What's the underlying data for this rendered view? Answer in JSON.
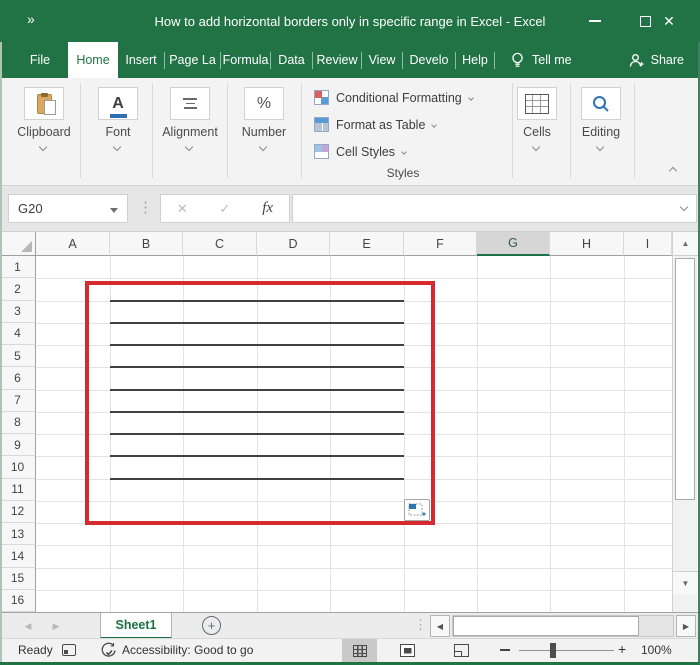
{
  "window": {
    "title": "How to add horizontal borders only in specific range in Excel - Excel"
  },
  "icons": {
    "quick_access": "»",
    "close": "✕",
    "cancel": "✕",
    "enter": "✓",
    "dots": "⋮",
    "up_arrow": "▲",
    "down_arrow": "▼",
    "left_arrow": "◀",
    "right_arrow": "▶",
    "plus": "+"
  },
  "menu": {
    "tabs": [
      {
        "label": "File",
        "active": false
      },
      {
        "label": "Home",
        "active": true
      },
      {
        "label": "Insert",
        "active": false
      },
      {
        "label": "Page La",
        "active": false
      },
      {
        "label": "Formula",
        "active": false
      },
      {
        "label": "Data",
        "active": false
      },
      {
        "label": "Review",
        "active": false
      },
      {
        "label": "View",
        "active": false
      },
      {
        "label": "Develo",
        "active": false
      },
      {
        "label": "Help",
        "active": false
      }
    ],
    "tell_me": "Tell me",
    "share": "Share"
  },
  "ribbon": {
    "groups": [
      {
        "label": "Clipboard",
        "icon": "clipboard-icon"
      },
      {
        "label": "Font",
        "icon": "font-underline-icon"
      },
      {
        "label": "Alignment",
        "icon": "align-lines-icon"
      },
      {
        "label": "Number",
        "icon": "percent-icon"
      }
    ],
    "styles": {
      "items": [
        {
          "label": "Conditional Formatting"
        },
        {
          "label": "Format as Table"
        },
        {
          "label": "Cell Styles"
        }
      ],
      "label": "Styles"
    },
    "cells": {
      "label": "Cells",
      "icon": "cells-grid-icon"
    },
    "editing": {
      "label": "Editing",
      "icon": "magnifier-icon"
    }
  },
  "formula_bar": {
    "name_box_value": "G20",
    "fx_label": "fx",
    "formula_value": ""
  },
  "grid": {
    "column_headers": [
      "A",
      "B",
      "C",
      "D",
      "E",
      "F",
      "G",
      "H",
      "I"
    ],
    "selected_column": "G",
    "row_headers": [
      "1",
      "2",
      "3",
      "4",
      "5",
      "6",
      "7",
      "8",
      "9",
      "10",
      "11",
      "12",
      "13",
      "14",
      "15",
      "16"
    ],
    "drawn_borders": {
      "first_row": 2,
      "last_row": 10,
      "columns": "B:E",
      "line_color": "#404040"
    },
    "annotation_box": {
      "color": "#d52b30",
      "around": "B2:E12"
    }
  },
  "sheet_bar": {
    "tabs": [
      {
        "label": "Sheet1",
        "active": true
      }
    ],
    "add_sheet": "+"
  },
  "status_bar": {
    "mode": "Ready",
    "accessibility": "Accessibility: Good to go",
    "zoom_level": "100%"
  },
  "colors": {
    "titlebar": "#217346",
    "accent_green": "#1e7145",
    "annotation_red": "#d52b30"
  }
}
